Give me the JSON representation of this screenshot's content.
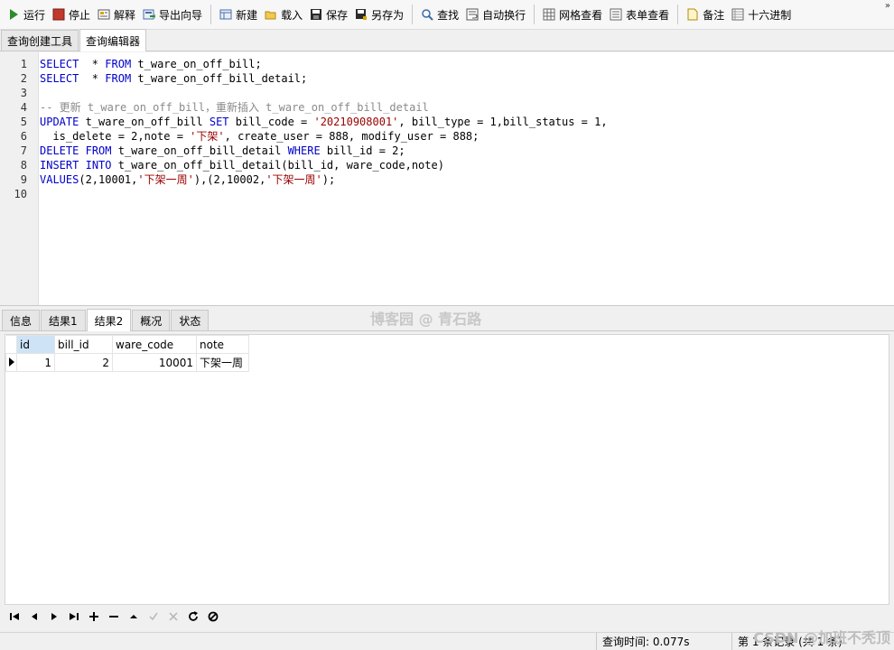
{
  "toolbar": {
    "run": "运行",
    "stop": "停止",
    "explain": "解释",
    "export_wizard": "导出向导",
    "new": "新建",
    "load": "载入",
    "save": "保存",
    "save_as": "另存为",
    "find": "查找",
    "word_wrap": "自动换行",
    "grid_view": "网格查看",
    "form_view": "表单查看",
    "memo": "备注",
    "hex": "十六进制",
    "more": "»"
  },
  "top_tabs": [
    "查询创建工具",
    "查询编辑器"
  ],
  "editor": {
    "line_numbers": [
      "1",
      "2",
      "3",
      "4",
      "5",
      "6",
      "7",
      "8",
      "9",
      "10"
    ],
    "lines": [
      [
        [
          "kw",
          "SELECT"
        ],
        [
          "",
          "  * "
        ],
        [
          "kw",
          "FROM"
        ],
        [
          "",
          " t_ware_on_off_bill;"
        ]
      ],
      [
        [
          "kw",
          "SELECT"
        ],
        [
          "",
          "  * "
        ],
        [
          "kw",
          "FROM"
        ],
        [
          "",
          " t_ware_on_off_bill_detail;"
        ]
      ],
      [],
      [
        [
          "cm",
          "-- 更新 t_ware_on_off_bill，重新插入 t_ware_on_off_bill_detail"
        ]
      ],
      [
        [
          "kw",
          "UPDATE"
        ],
        [
          "",
          " t_ware_on_off_bill "
        ],
        [
          "kw",
          "SET"
        ],
        [
          "",
          " bill_code = "
        ],
        [
          "str",
          "'20210908001'"
        ],
        [
          "",
          ", bill_type = 1,bill_status = 1,"
        ]
      ],
      [
        [
          "",
          "  is_delete = 2,note = "
        ],
        [
          "str",
          "'下架'"
        ],
        [
          "",
          ", create_user = 888, modify_user = 888;"
        ]
      ],
      [
        [
          "kw",
          "DELETE"
        ],
        [
          "",
          " "
        ],
        [
          "kw",
          "FROM"
        ],
        [
          "",
          " t_ware_on_off_bill_detail "
        ],
        [
          "kw",
          "WHERE"
        ],
        [
          "",
          " bill_id = 2;"
        ]
      ],
      [
        [
          "kw",
          "INSERT"
        ],
        [
          "",
          " "
        ],
        [
          "kw",
          "INTO"
        ],
        [
          "",
          " t_ware_on_off_bill_detail(bill_id, ware_code,note)"
        ]
      ],
      [
        [
          "kw",
          "VALUES"
        ],
        [
          "",
          "(2,10001,"
        ],
        [
          "str",
          "'下架一周'"
        ],
        [
          "",
          "),(2,10002,"
        ],
        [
          "str",
          "'下架一周'"
        ],
        [
          "",
          ");"
        ]
      ],
      []
    ],
    "watermark": "博客园 @ 青石路"
  },
  "result_tabs": [
    "信息",
    "结果1",
    "结果2",
    "概况",
    "状态"
  ],
  "result_grid": {
    "columns": [
      "id",
      "bill_id",
      "ware_code",
      "note"
    ],
    "rows": [
      [
        "1",
        "2",
        "10001",
        "下架一周"
      ]
    ]
  },
  "nav_icons": [
    "first-record-icon",
    "prev-record-icon",
    "next-record-icon",
    "last-record-icon",
    "add-record-icon",
    "delete-record-icon",
    "up-icon",
    "apply-icon",
    "cancel-icon",
    "refresh-icon",
    "stop-icon"
  ],
  "status": {
    "query_time": "查询时间: 0.077s",
    "record_info": "第 1 条记录 (共 1 条)",
    "overlay_watermark": "CSDN @加班不秃顶"
  },
  "colors": {
    "keyword": "#0000cc",
    "string": "#990000",
    "comment": "#8a8a8a",
    "selected_header": "#cfe3f7"
  }
}
